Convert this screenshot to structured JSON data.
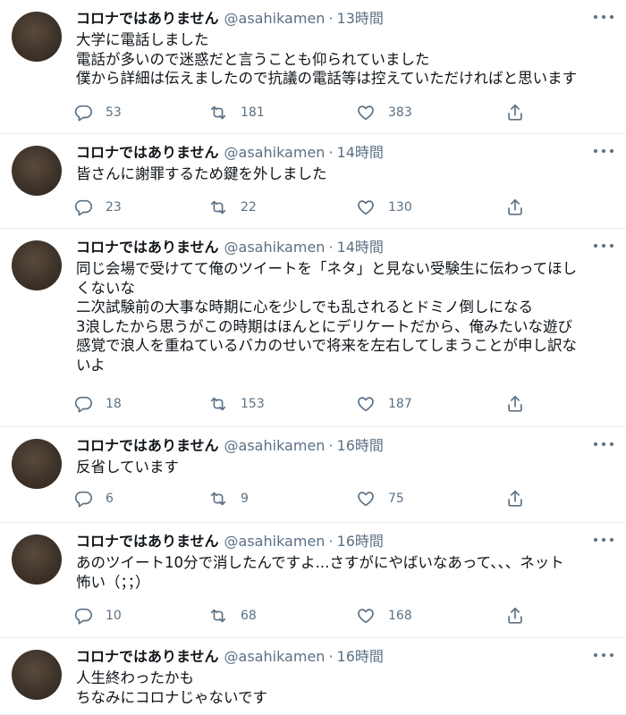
{
  "author": {
    "name": "コロナではありません",
    "handle": "@asahikamen",
    "separator": "·"
  },
  "tweets": [
    {
      "time": "13時間",
      "lines": [
        "大学に電話しました",
        "電話が多いので迷惑だと言うことも仰られていました",
        "僕から詳細は伝えましたので抗議の電話等は控えていただければと思います"
      ],
      "replies": "53",
      "retweets": "181",
      "likes": "383"
    },
    {
      "time": "14時間",
      "lines": [
        "皆さんに謝罪するため鍵を外しました"
      ],
      "replies": "23",
      "retweets": "22",
      "likes": "130"
    },
    {
      "time": "14時間",
      "lines": [
        "同じ会場で受けてて俺のツイートを「ネタ」と見ない受験生に伝わってほし",
        "くないな",
        "二次試験前の大事な時期に心を少しでも乱されるとドミノ倒しになる",
        "3浪したから思うがこの時期はほんとにデリケートだから、俺みたいな遊び",
        "感覚で浪人を重ねているバカのせいで将来を左右してしまうことが申し訳な",
        "いよ"
      ],
      "replies": "18",
      "retweets": "153",
      "likes": "187"
    },
    {
      "time": "16時間",
      "lines": [
        "反省しています"
      ],
      "replies": "6",
      "retweets": "9",
      "likes": "75"
    },
    {
      "time": "16時間",
      "lines": [
        "あのツイート10分で消したんですよ...さすがにやばいなあって、、、ネット",
        "怖い（；；）"
      ],
      "replies": "10",
      "retweets": "68",
      "likes": "168"
    },
    {
      "time": "16時間",
      "lines": [
        "人生終わったかも",
        "ちなみにコロナじゃないです"
      ]
    }
  ],
  "icons": {
    "reply": "reply-icon",
    "retweet": "retweet-icon",
    "like": "heart-icon",
    "share": "share-icon",
    "more": "more-icon"
  },
  "colors": {
    "text": "#0f1419",
    "secondary": "#5b7083",
    "divider": "#e6ecf0",
    "avatar": "#3c3128"
  }
}
